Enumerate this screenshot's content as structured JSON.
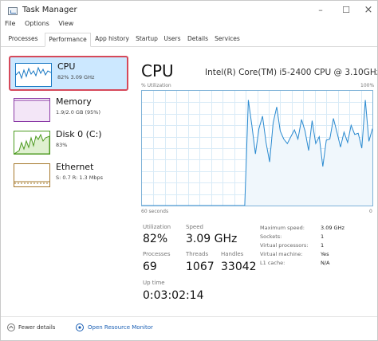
{
  "window": {
    "title": "Task Manager",
    "minimize": "–",
    "maximize": "☐",
    "close": "×"
  },
  "menu": [
    "File",
    "Options",
    "View"
  ],
  "tabs": [
    "Processes",
    "Performance",
    "App history",
    "Startup",
    "Users",
    "Details",
    "Services"
  ],
  "active_tab": "Performance",
  "sidebar": {
    "items": [
      {
        "title": "CPU",
        "sub": "82%  3.09 GHz",
        "color": "#1a79c4"
      },
      {
        "title": "Memory",
        "sub": "1.9/2.0 GB (95%)",
        "color": "#8b3aa6"
      },
      {
        "title": "Disk 0 (C:)",
        "sub": "83%",
        "color": "#4c9a1f"
      },
      {
        "title": "Ethernet",
        "sub": "S: 0.7  R: 1.3 Mbps",
        "color": "#a6782b"
      }
    ]
  },
  "main": {
    "title": "CPU",
    "model": "Intel(R) Core(TM) i5-2400 CPU @ 3.10GHz",
    "graph_label": "% Utilization",
    "graph_max": "100%",
    "graph_time": "60 seconds",
    "graph_min": "0",
    "utilization_history": [
      0,
      0,
      0,
      0,
      0,
      0,
      0,
      0,
      0,
      0,
      0,
      0,
      0,
      0,
      0,
      0,
      0,
      0,
      0,
      0,
      0,
      0,
      0,
      0,
      0,
      0,
      0,
      0,
      0,
      0,
      92,
      70,
      45,
      67,
      78,
      55,
      38,
      72,
      86,
      65,
      58,
      54,
      60,
      66,
      58,
      75,
      65,
      48,
      74,
      54,
      60,
      34,
      57,
      58,
      76,
      64,
      51,
      64,
      55,
      70,
      62,
      63,
      50,
      92,
      56,
      67
    ]
  },
  "stats": {
    "utilization": {
      "label": "Utilization",
      "value": "82%"
    },
    "speed": {
      "label": "Speed",
      "value": "3.09 GHz"
    },
    "processes": {
      "label": "Processes",
      "value": "69"
    },
    "threads": {
      "label": "Threads",
      "value": "1067"
    },
    "handles": {
      "label": "Handles",
      "value": "33042"
    },
    "uptime": {
      "label": "Up time",
      "value": "0:03:02:14"
    }
  },
  "details": [
    {
      "key": "Maximum speed:",
      "value": "3.09 GHz"
    },
    {
      "key": "Sockets:",
      "value": "1"
    },
    {
      "key": "Virtual processors:",
      "value": "1"
    },
    {
      "key": "Virtual machine:",
      "value": "Yes"
    },
    {
      "key": "L1 cache:",
      "value": "N/A"
    }
  ],
  "footer": {
    "fewer_details": "Fewer details",
    "open_monitor": "Open Resource Monitor"
  },
  "colors": {
    "cpu_line": "#2a8ad0",
    "cpu_fill": "#f0f7fc",
    "grid": "#d9ebf7",
    "link": "#1a5fb4"
  }
}
